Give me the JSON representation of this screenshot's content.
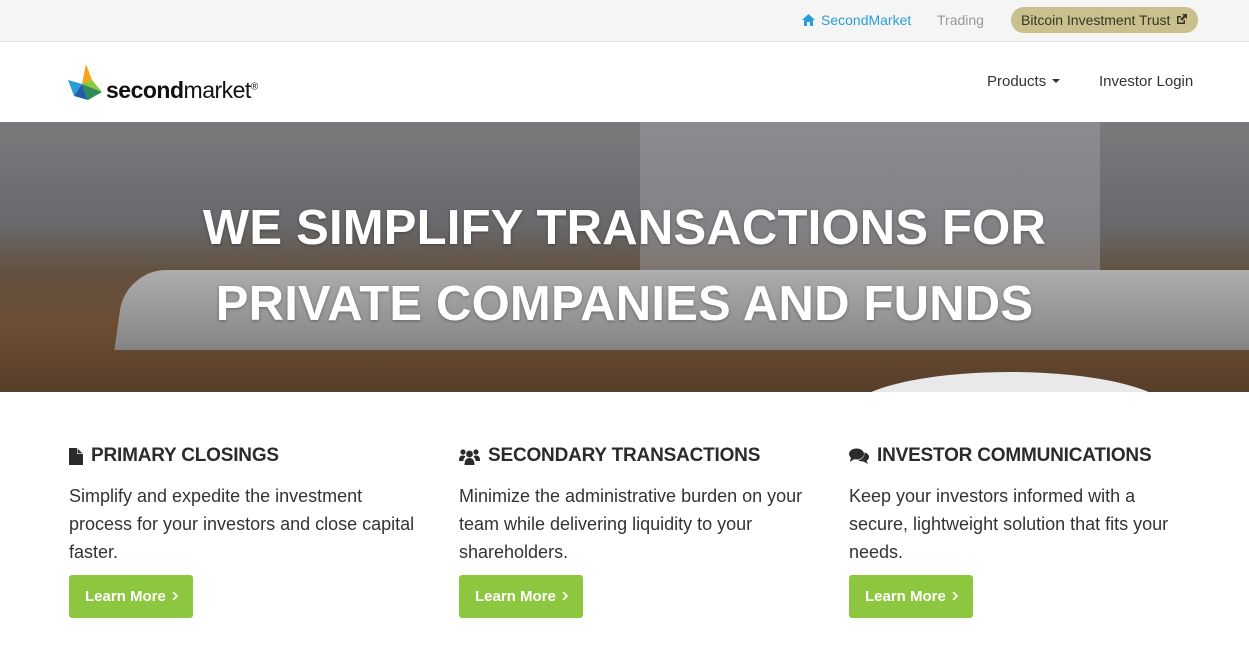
{
  "topbar": {
    "home_label": "SecondMarket",
    "trading_label": "Trading",
    "btc_label": "Bitcoin Investment Trust"
  },
  "navbar": {
    "logo_text_bold": "second",
    "logo_text_light": "market",
    "logo_mark": "®",
    "products_label": "Products",
    "login_label": "Investor Login"
  },
  "hero": {
    "line1": "WE SIMPLIFY TRANSACTIONS FOR",
    "line2": "PRIVATE COMPANIES AND FUNDS"
  },
  "features": [
    {
      "icon": "document-icon",
      "title": "PRIMARY CLOSINGS",
      "desc": "Simplify and expedite the investment process for your investors and close capital faster.",
      "button": "Learn More"
    },
    {
      "icon": "users-icon",
      "title": "SECONDARY TRANSACTIONS",
      "desc": "Minimize the administrative burden on your team while delivering liquidity to your shareholders.",
      "button": "Learn More"
    },
    {
      "icon": "comments-icon",
      "title": "INVESTOR COMMUNICATIONS",
      "desc": "Keep your investors informed with a secure, lightweight solution that fits your needs.",
      "button": "Learn More"
    }
  ],
  "colors": {
    "link_blue": "#2a9fd6",
    "btc_badge": "#c9c08e",
    "button_green": "#8dc63f"
  }
}
